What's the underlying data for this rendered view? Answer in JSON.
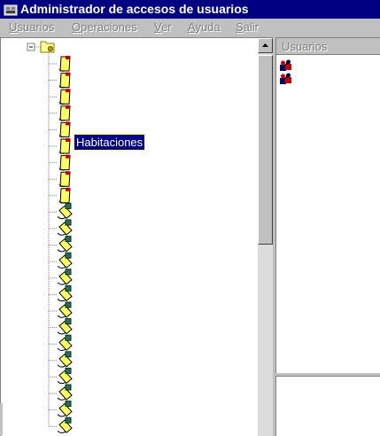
{
  "window": {
    "title": "Administrador de accesos de usuarios"
  },
  "menu": [
    {
      "label": "Usuarios",
      "accel_index": 0
    },
    {
      "label": "Operaciones",
      "accel_index": 0
    },
    {
      "label": "Ver",
      "accel_index": 0
    },
    {
      "label": "Ayuda",
      "accel_index": 0
    },
    {
      "label": "Salir",
      "accel_index": 0
    }
  ],
  "tree": {
    "root_icon": "folder-icon",
    "selected_label": "Habitaciones",
    "items": [
      {
        "icon": "document-icon",
        "selected": false
      },
      {
        "icon": "document-icon",
        "selected": false
      },
      {
        "icon": "document-icon",
        "selected": false
      },
      {
        "icon": "document-icon",
        "selected": false
      },
      {
        "icon": "document-icon",
        "selected": true
      },
      {
        "icon": "document-icon",
        "selected": false
      },
      {
        "icon": "document-icon",
        "selected": false
      },
      {
        "icon": "document-icon",
        "selected": false
      },
      {
        "icon": "document-icon",
        "selected": false
      },
      {
        "icon": "key-document-icon",
        "selected": false
      },
      {
        "icon": "key-document-icon",
        "selected": false
      },
      {
        "icon": "key-document-icon",
        "selected": false
      },
      {
        "icon": "key-document-icon",
        "selected": false
      },
      {
        "icon": "key-document-icon",
        "selected": false
      },
      {
        "icon": "key-document-icon",
        "selected": false
      },
      {
        "icon": "key-document-icon",
        "selected": false
      },
      {
        "icon": "key-document-icon",
        "selected": false
      },
      {
        "icon": "key-document-icon",
        "selected": false
      },
      {
        "icon": "key-document-icon",
        "selected": false
      },
      {
        "icon": "key-document-icon",
        "selected": false
      },
      {
        "icon": "key-document-icon",
        "selected": false
      },
      {
        "icon": "key-document-icon",
        "selected": false
      },
      {
        "icon": "key-document-icon",
        "selected": false
      }
    ]
  },
  "users": {
    "header": "Usuarios",
    "items": [
      {
        "icon": "user-icon"
      },
      {
        "icon": "user-icon"
      }
    ]
  },
  "colors": {
    "title_bg": "#000080",
    "selection_bg": "#000080",
    "window_bg": "#c0c0c0",
    "doc_yellow": "#ffff66",
    "doc_red": "#c00000",
    "key_green": "#2a6f4f"
  }
}
